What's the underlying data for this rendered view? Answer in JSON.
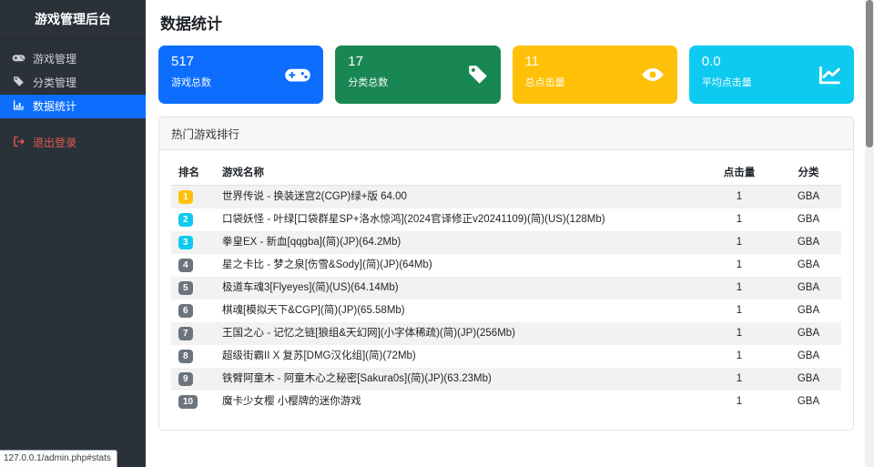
{
  "colors": {
    "primary": "#0d6efd",
    "success": "#198754",
    "warning": "#ffc107",
    "info": "#0dcaf0",
    "secondary": "#6c757d",
    "sidebar_bg": "#2b3139",
    "logout_red": "#e25a4d"
  },
  "sidebar": {
    "title": "游戏管理后台",
    "items": [
      {
        "label": "游戏管理",
        "icon": "gamepad-icon",
        "active": false
      },
      {
        "label": "分类管理",
        "icon": "tag-icon",
        "active": false
      },
      {
        "label": "数据统计",
        "icon": "bar-chart-icon",
        "active": true
      }
    ],
    "logout_label": "退出登录"
  },
  "header": {
    "title": "数据统计"
  },
  "stat_cards": [
    {
      "value": "517",
      "label": "游戏总数",
      "icon": "gamepad-icon",
      "color": "#0d6efd"
    },
    {
      "value": "17",
      "label": "分类总数",
      "icon": "tag-icon",
      "color": "#198754"
    },
    {
      "value": "11",
      "label": "总点击量",
      "icon": "eye-icon",
      "color": "#ffc107"
    },
    {
      "value": "0.0",
      "label": "平均点击量",
      "icon": "line-chart-icon",
      "color": "#0dcaf0"
    }
  ],
  "ranking_panel": {
    "title": "热门游戏排行",
    "columns": [
      "排名",
      "游戏名称",
      "点击量",
      "分类"
    ],
    "rows": [
      {
        "rank": "1",
        "name": "世界传说 - 换装迷宫2(CGP)绿+版 64.00",
        "clicks": "1",
        "category": "GBA",
        "badge_color": "#ffc107"
      },
      {
        "rank": "2",
        "name": "口袋妖怪 - 叶绿[口袋群星SP+洛水惊鸿](2024官译修正v20241109)(简)(US)(128Mb)",
        "clicks": "1",
        "category": "GBA",
        "badge_color": "#0dcaf0"
      },
      {
        "rank": "3",
        "name": "拳皇EX - 新血[qqgba](简)(JP)(64.2Mb)",
        "clicks": "1",
        "category": "GBA",
        "badge_color": "#0dcaf0"
      },
      {
        "rank": "4",
        "name": "星之卡比 - 梦之泉[伤雪&Sody](简)(JP)(64Mb)",
        "clicks": "1",
        "category": "GBA",
        "badge_color": "#6c757d"
      },
      {
        "rank": "5",
        "name": "极道车魂3[Flyeyes](简)(US)(64.14Mb)",
        "clicks": "1",
        "category": "GBA",
        "badge_color": "#6c757d"
      },
      {
        "rank": "6",
        "name": "棋魂[模拟天下&CGP](简)(JP)(65.58Mb)",
        "clicks": "1",
        "category": "GBA",
        "badge_color": "#6c757d"
      },
      {
        "rank": "7",
        "name": "王国之心 - 记忆之链[狼组&天幻网](小字体稀疏)(简)(JP)(256Mb)",
        "clicks": "1",
        "category": "GBA",
        "badge_color": "#6c757d"
      },
      {
        "rank": "8",
        "name": "超级街霸II X 复苏[DMG汉化组](简)(72Mb)",
        "clicks": "1",
        "category": "GBA",
        "badge_color": "#6c757d"
      },
      {
        "rank": "9",
        "name": "铁臂阿童木 - 阿童木心之秘密[Sakura0s](简)(JP)(63.23Mb)",
        "clicks": "1",
        "category": "GBA",
        "badge_color": "#6c757d"
      },
      {
        "rank": "10",
        "name": "魔卡少女樱 小樱牌的迷你游戏",
        "clicks": "1",
        "category": "GBA",
        "badge_color": "#6c757d"
      }
    ]
  },
  "status_bar": {
    "url": "127.0.0.1/admin.php#stats"
  }
}
